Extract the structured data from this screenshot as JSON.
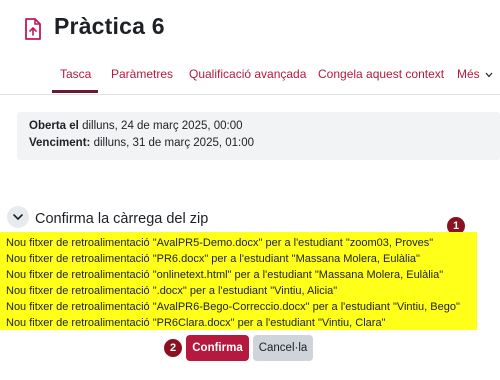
{
  "header": {
    "title": "Pràctica 6",
    "icon": "assignment-icon"
  },
  "tabs": [
    {
      "label": "Tasca",
      "active": true
    },
    {
      "label": "Paràmetres"
    },
    {
      "label": "Qualificació avançada"
    },
    {
      "label": "Congela aquest context"
    },
    {
      "label": "Més"
    }
  ],
  "dates": {
    "opened_label": "Oberta el",
    "opened_value": "dilluns, 24 de març 2025, 00:00",
    "due_label": "Venciment:",
    "due_value": "dilluns, 31 de març 2025, 01:00"
  },
  "section": {
    "title": "Confirma la càrrega del zip",
    "collapse_icon": "chevron-down-icon"
  },
  "annotations": {
    "badge1": "1",
    "badge2": "2"
  },
  "feedback_lines": [
    "Nou fitxer de retroalimentació \"AvalPR5-Demo.docx\" per a l'estudiant \"zoom03, Proves\"",
    "Nou fitxer de retroalimentació \"PR6.docx\" per a l'estudiant \"Massana Molera, Eulàlia\"",
    "Nou fitxer de retroalimentació \"onlinetext.html\" per a l'estudiant \"Massana Molera, Eulàlia\"",
    "Nou fitxer de retroalimentació \".docx\" per a l'estudiant \"Vintiu, Alicia\"",
    "Nou fitxer de retroalimentació \"AvalPR6-Bego-Correccio.docx\" per a l'estudiant \"Vintiu, Bego\"",
    "Nou fitxer de retroalimentació \"PR6Clara.docx\" per a l'estudiant \"Vintiu, Clara\""
  ],
  "buttons": {
    "confirm": "Confirma",
    "cancel": "Cancel·la"
  },
  "colors": {
    "accent": "#b5193d",
    "highlight": "#ffff19",
    "badge": "#8b1020"
  }
}
